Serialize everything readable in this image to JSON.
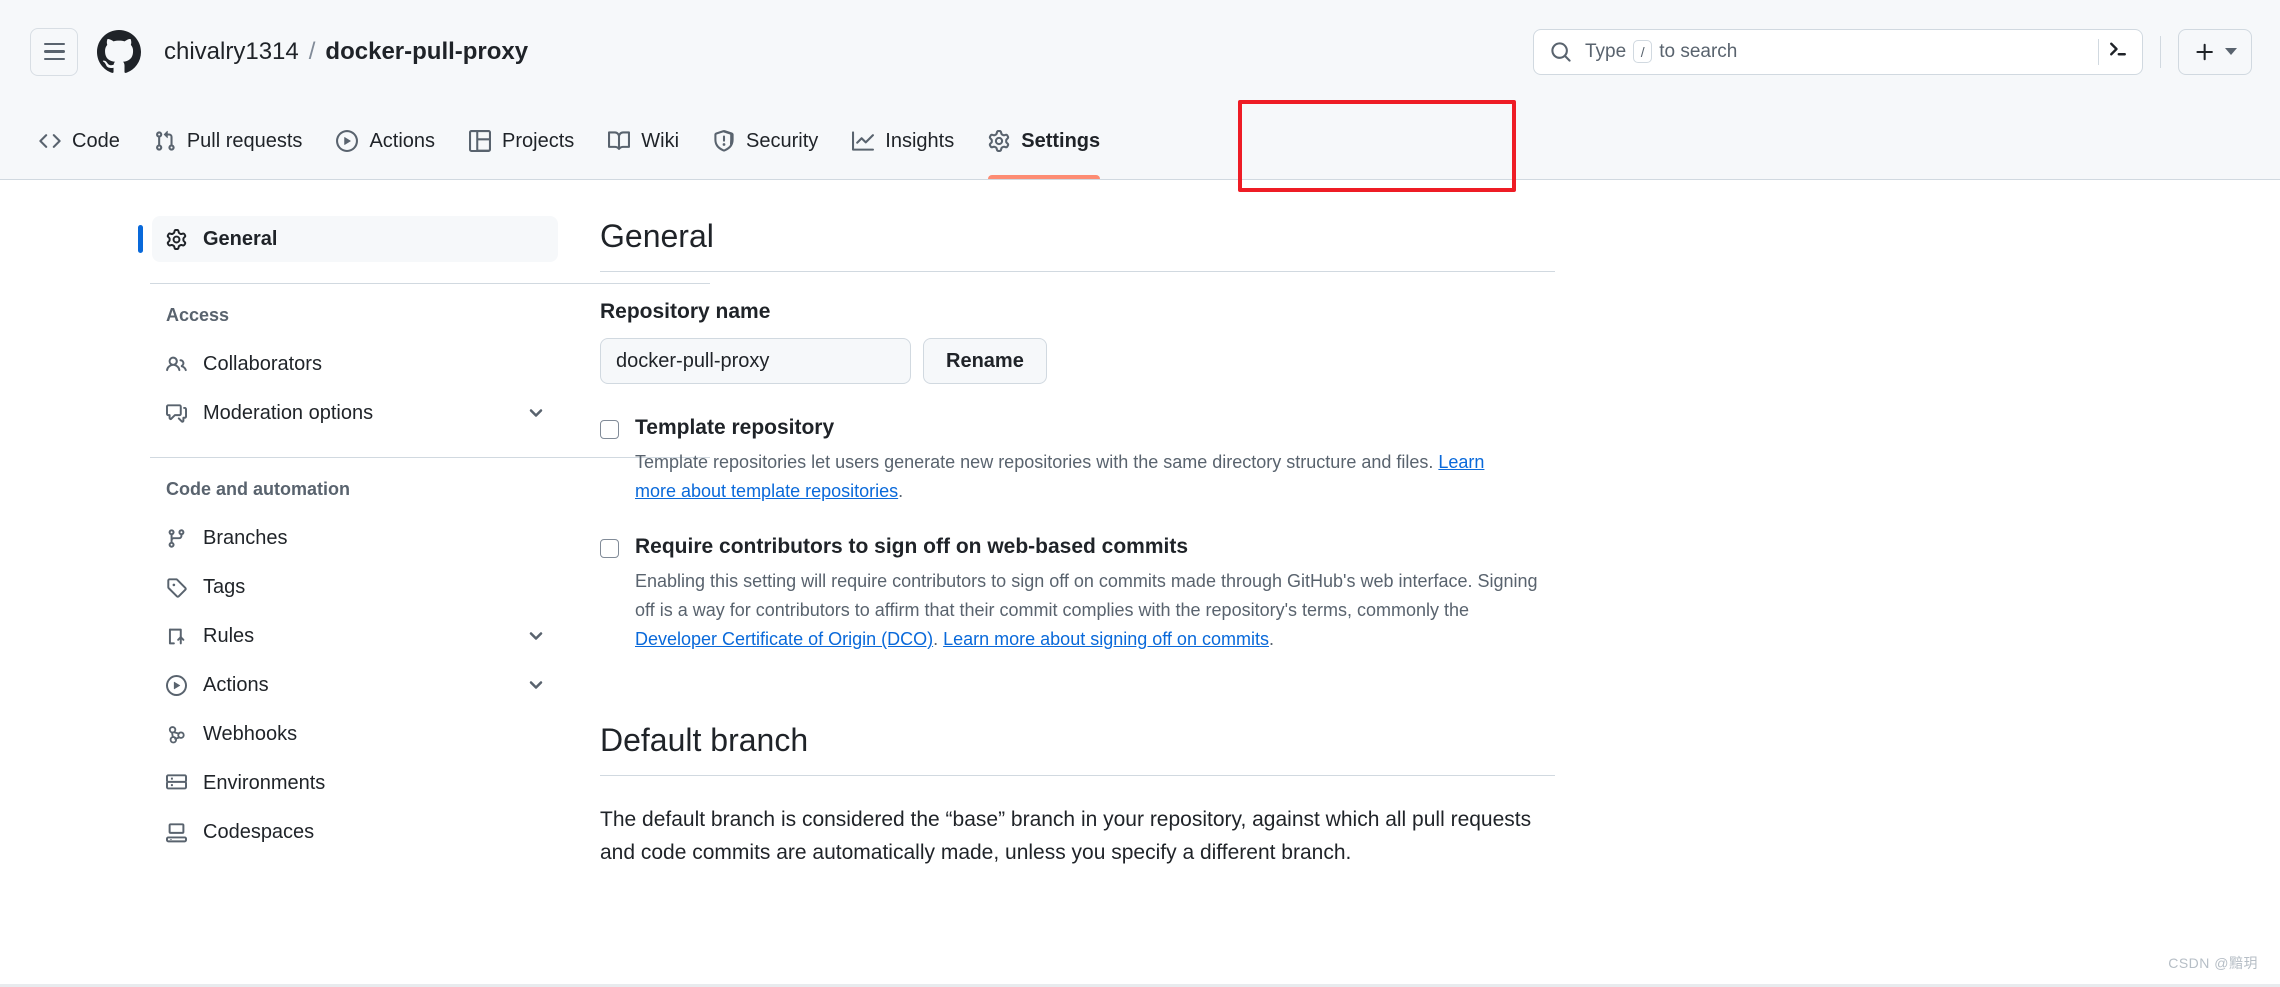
{
  "header": {
    "menu_icon": "hamburger-icon",
    "logo_icon": "github-logo-icon",
    "owner": "chivalry1314",
    "separator": "/",
    "repo": "docker-pull-proxy",
    "search": {
      "icon": "search-icon",
      "prefix": "Type",
      "key": "/",
      "suffix": "to search",
      "terminal_icon": "terminal-icon"
    },
    "create_new": {
      "icon": "plus-icon",
      "caret": "chevron-down-icon"
    }
  },
  "repo_nav": {
    "tabs": [
      {
        "label": "Code",
        "icon": "code-icon",
        "active": false
      },
      {
        "label": "Pull requests",
        "icon": "git-pull-request-icon",
        "active": false
      },
      {
        "label": "Actions",
        "icon": "play-circle-icon",
        "active": false
      },
      {
        "label": "Projects",
        "icon": "table-icon",
        "active": false
      },
      {
        "label": "Wiki",
        "icon": "book-icon",
        "active": false
      },
      {
        "label": "Security",
        "icon": "shield-icon",
        "active": false
      },
      {
        "label": "Insights",
        "icon": "graph-icon",
        "active": false
      },
      {
        "label": "Settings",
        "icon": "gear-icon",
        "active": true
      }
    ],
    "highlight_color": "#ee1c25",
    "active_underline_color": "#fd8c73"
  },
  "sidebar": {
    "top_item": {
      "label": "General",
      "icon": "gear-icon",
      "active": true
    },
    "groups": [
      {
        "title": "Access",
        "items": [
          {
            "label": "Collaborators",
            "icon": "people-icon",
            "expandable": false
          },
          {
            "label": "Moderation options",
            "icon": "comment-discussion-icon",
            "expandable": true
          }
        ]
      },
      {
        "title": "Code and automation",
        "items": [
          {
            "label": "Branches",
            "icon": "git-branch-icon",
            "expandable": false
          },
          {
            "label": "Tags",
            "icon": "tag-icon",
            "expandable": false
          },
          {
            "label": "Rules",
            "icon": "rules-icon",
            "expandable": true
          },
          {
            "label": "Actions",
            "icon": "play-circle-icon",
            "expandable": true
          },
          {
            "label": "Webhooks",
            "icon": "webhook-icon",
            "expandable": false
          },
          {
            "label": "Environments",
            "icon": "server-icon",
            "expandable": false
          },
          {
            "label": "Codespaces",
            "icon": "codespaces-icon",
            "expandable": false
          }
        ]
      }
    ],
    "active_indicator_color": "#0969da"
  },
  "main": {
    "general": {
      "title": "General",
      "repository_name_label": "Repository name",
      "repository_name_value": "docker-pull-proxy",
      "repository_name_placeholder": "Repository name",
      "rename_button": "Rename",
      "template_repository": {
        "title": "Template repository",
        "checked": false,
        "description_before": "Template repositories let users generate new repositories with the same directory structure and files. ",
        "link_text": "Learn more about template repositories",
        "description_after": "."
      },
      "signoff": {
        "title": "Require contributors to sign off on web-based commits",
        "checked": false,
        "description_before": "Enabling this setting will require contributors to sign off on commits made through GitHub's web interface. Signing off is a way for contributors to affirm that their commit complies with the repository's terms, commonly the ",
        "link_one": "Developer Certificate of Origin (DCO)",
        "description_mid": ". ",
        "link_two": "Learn more about signing off on commits",
        "description_after": "."
      }
    },
    "default_branch": {
      "title": "Default branch",
      "description": "The default branch is considered the “base” branch in your repository, against which all pull requests and code commits are automatically made, unless you specify a different branch."
    }
  },
  "watermark": "CSDN @黯玥"
}
